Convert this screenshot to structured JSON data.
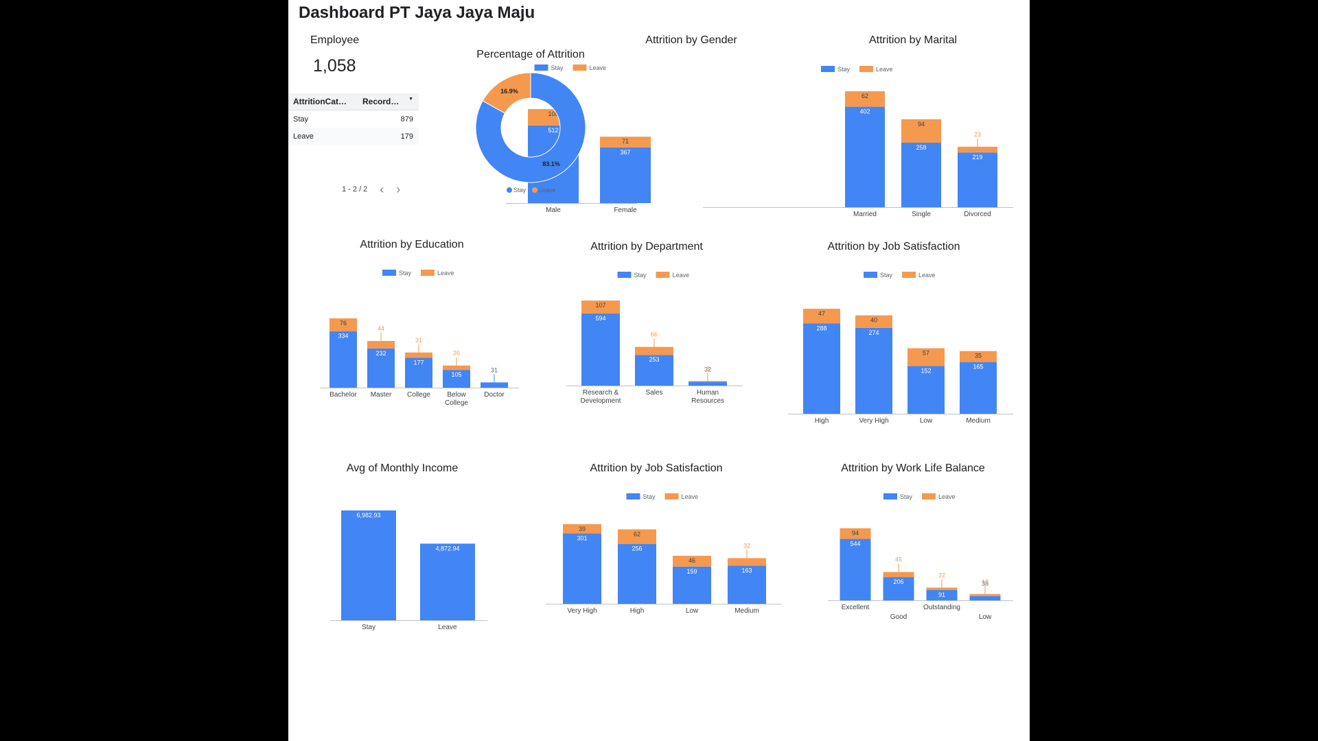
{
  "dashboard": {
    "title": "Dashboard PT Jaya Jaya Maju",
    "kpi": {
      "label": "Employee",
      "value": "1,058"
    },
    "table": {
      "col1": "AttritionCat…",
      "col2": "Record…",
      "rows": [
        {
          "category": "Stay",
          "count": "879"
        },
        {
          "category": "Leave",
          "count": "179"
        }
      ],
      "pagination": "1 - 2 / 2"
    },
    "legend": {
      "stay": "Stay",
      "leave": "Leave"
    },
    "colors": {
      "stay": "#4285f4",
      "leave": "#f5994e"
    }
  },
  "chart_data": [
    {
      "id": "donut",
      "type": "pie",
      "title": "Percentage of Attrition",
      "slices": [
        {
          "label": "Stay",
          "value": 83.1,
          "text": "83.1%"
        },
        {
          "label": "Leave",
          "value": 16.9,
          "text": "16.9%"
        }
      ]
    },
    {
      "id": "gender",
      "type": "bar",
      "stacked": true,
      "title": "Attrition by Gender",
      "categories": [
        "Male",
        "Female"
      ],
      "series": [
        {
          "name": "Stay",
          "values": [
            512,
            367
          ]
        },
        {
          "name": "Leave",
          "values": [
            108,
            71
          ]
        }
      ],
      "ylim": [
        0,
        620
      ]
    },
    {
      "id": "marital",
      "type": "bar",
      "stacked": true,
      "title": "Attrition by Marital",
      "categories": [
        "Married",
        "Single",
        "Divorced"
      ],
      "series": [
        {
          "name": "Stay",
          "values": [
            402,
            258,
            219
          ]
        },
        {
          "name": "Leave",
          "values": [
            62,
            94,
            23
          ]
        }
      ],
      "ylim": [
        0,
        464
      ]
    },
    {
      "id": "education",
      "type": "bar",
      "stacked": true,
      "title": "Attrition by Education",
      "categories": [
        "Bachelor",
        "Master",
        "College",
        "Below College",
        "Doctor"
      ],
      "series": [
        {
          "name": "Stay",
          "values": [
            334,
            232,
            177,
            105,
            31
          ]
        },
        {
          "name": "Leave",
          "values": [
            76,
            44,
            31,
            26,
            0
          ]
        }
      ],
      "ylim": [
        0,
        410
      ]
    },
    {
      "id": "department",
      "type": "bar",
      "stacked": true,
      "title": "Attrition by Department",
      "categories": [
        "Research & Development",
        "Sales",
        "Human Resources"
      ],
      "series": [
        {
          "name": "Stay",
          "values": [
            594,
            253,
            32
          ]
        },
        {
          "name": "Leave",
          "values": [
            107,
            66,
            6
          ]
        }
      ],
      "ylim": [
        0,
        701
      ]
    },
    {
      "id": "jobsat1",
      "type": "bar",
      "stacked": true,
      "title": "Attrition by Job Satisfaction",
      "categories": [
        "High",
        "Very High",
        "Low",
        "Medium"
      ],
      "series": [
        {
          "name": "Stay",
          "values": [
            288,
            274,
            152,
            165
          ]
        },
        {
          "name": "Leave",
          "values": [
            47,
            40,
            57,
            35
          ]
        }
      ],
      "ylim": [
        0,
        335
      ]
    },
    {
      "id": "income",
      "type": "bar",
      "stacked": false,
      "title": "Avg of Monthly Income",
      "categories": [
        "Stay",
        "Leave"
      ],
      "series": [
        {
          "name": "Avg of Monthly Income",
          "values": [
            6982.93,
            4872.94
          ],
          "labels": [
            "6,982.93",
            "4,872.94"
          ]
        }
      ],
      "ylim": [
        0,
        6982.93
      ]
    },
    {
      "id": "jobsat2",
      "type": "bar",
      "stacked": true,
      "title": "Attrition by Job Satisfaction",
      "categories": [
        "Very High",
        "High",
        "Low",
        "Medium"
      ],
      "series": [
        {
          "name": "Stay",
          "values": [
            301,
            256,
            159,
            163
          ]
        },
        {
          "name": "Leave",
          "values": [
            39,
            62,
            46,
            32
          ]
        }
      ],
      "ylim": [
        0,
        340
      ]
    },
    {
      "id": "wlb",
      "type": "bar",
      "stacked": true,
      "title": "Attrition by Work Life Balance",
      "categories": [
        "Excellent",
        "Good",
        "Outstanding",
        "Low"
      ],
      "series": [
        {
          "name": "Stay",
          "values": [
            544,
            206,
            91,
            38
          ]
        },
        {
          "name": "Leave",
          "values": [
            94,
            45,
            22,
            18
          ]
        }
      ],
      "ylim": [
        0,
        638
      ]
    }
  ]
}
